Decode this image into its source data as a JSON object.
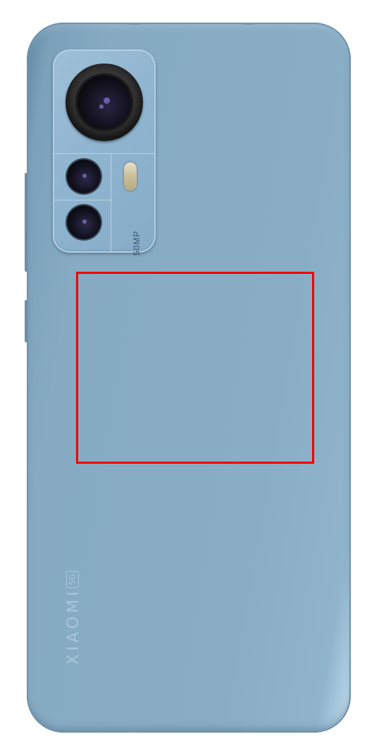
{
  "phone": {
    "color": "#88adc5",
    "camera_module": {
      "megapixel_label": "50MP"
    },
    "brand_text": "XIAOMI",
    "network_badge": "5G"
  },
  "highlight": {
    "color": "#ee0000"
  }
}
